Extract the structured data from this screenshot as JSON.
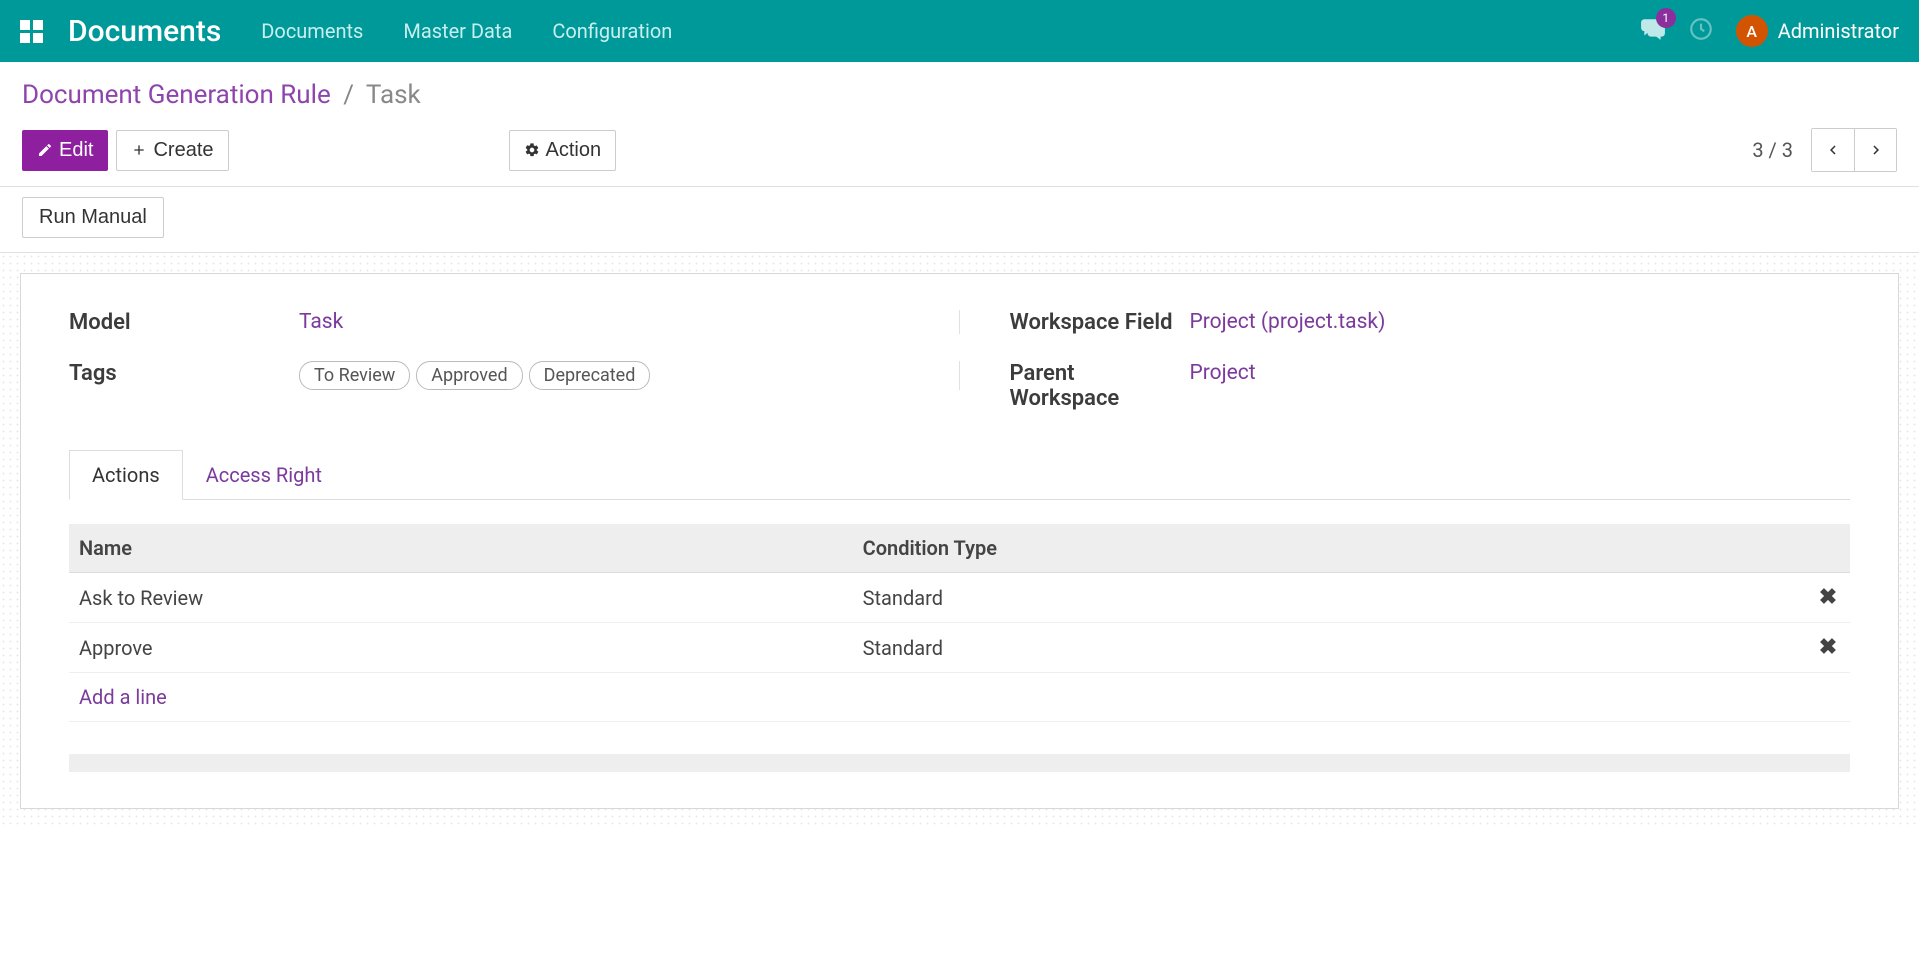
{
  "nav": {
    "app_title": "Documents",
    "links": [
      "Documents",
      "Master Data",
      "Configuration"
    ],
    "badge_count": "1",
    "avatar_letter": "A",
    "username": "Administrator"
  },
  "breadcrumb": {
    "parent": "Document Generation Rule",
    "sep": "/",
    "current": "Task"
  },
  "buttons": {
    "edit": "Edit",
    "create": "Create",
    "action": "Action",
    "run_manual": "Run Manual"
  },
  "pager": {
    "text": "3 / 3"
  },
  "fields": {
    "model_label": "Model",
    "model_value": "Task",
    "tags_label": "Tags",
    "tags": [
      "To Review",
      "Approved",
      "Deprecated"
    ],
    "workspace_field_label": "Workspace Field",
    "workspace_field_value": "Project (project.task)",
    "parent_workspace_label": "Parent Workspace",
    "parent_workspace_value": "Project"
  },
  "tabs": {
    "items": [
      {
        "label": "Actions",
        "active": true
      },
      {
        "label": "Access Right",
        "active": false
      }
    ]
  },
  "table": {
    "headers": [
      "Name",
      "Condition Type"
    ],
    "rows": [
      {
        "name": "Ask to Review",
        "cond": "Standard"
      },
      {
        "name": "Approve",
        "cond": "Standard"
      }
    ],
    "add_line": "Add a line"
  }
}
